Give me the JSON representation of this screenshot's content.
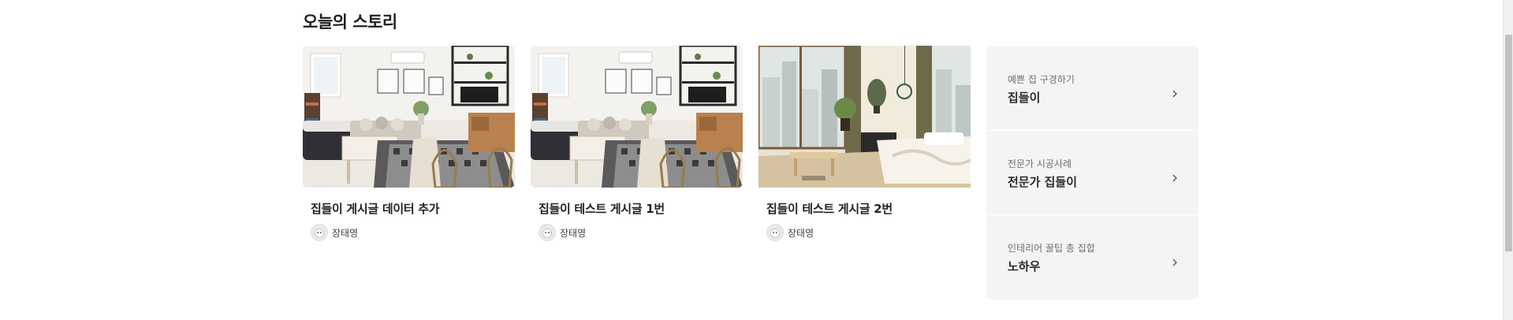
{
  "section": {
    "title": "오늘의 스토리"
  },
  "cards": [
    {
      "title": "집들이 게시글 데이터 추가",
      "author": "장태영",
      "image": "living-room-photo"
    },
    {
      "title": "집들이 테스트 게시글 1번",
      "author": "장태영",
      "image": "living-room-photo"
    },
    {
      "title": "집들이 테스트 게시글 2번",
      "author": "장태영",
      "image": "bright-window-room-photo"
    }
  ],
  "side_menu": [
    {
      "subtitle": "예쁜 집 구경하기",
      "title": "집들이"
    },
    {
      "subtitle": "전문가 시공사례",
      "title": "전문가 집들이"
    },
    {
      "subtitle": "인테리어 꿀팁 총 집합",
      "title": "노하우"
    }
  ],
  "icons": {
    "chevron": "chevron-right-icon",
    "avatar": "avatar-icon"
  },
  "colors": {
    "panel_bg": "#f4f4f4",
    "text_primary": "#292929",
    "text_secondary": "#6e6e6e"
  }
}
